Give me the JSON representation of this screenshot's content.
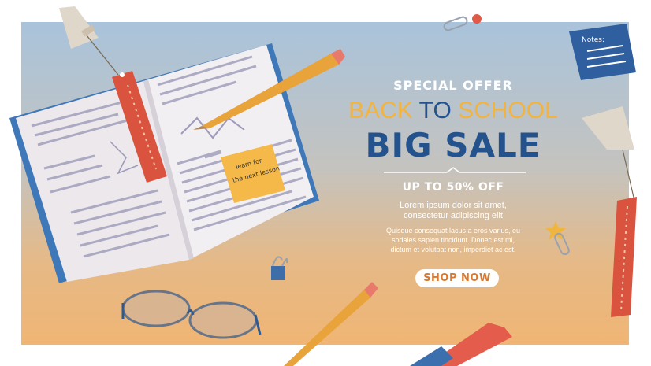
{
  "banner": {
    "special_offer": "SPECIAL OFFER",
    "headline_part1": "BACK",
    "headline_part2": "TO",
    "headline_part3": "SCHOOL",
    "big_sale": "BIG SALE",
    "discount": "UP TO 50% OFF",
    "lead_text": "Lorem ipsum dolor sit amet, consectetur adipiscing elit",
    "body_text": "Quisque consequat lacus a eros varius, eu sodales sapien tincidunt. Donec est mi, dictum et volutpat non, imperdiet ac est.",
    "cta_label": "SHOP NOW"
  },
  "sticky_note": {
    "text_line1": "learn for",
    "text_line2": "the next lesson"
  },
  "notes_card": {
    "title": "Notes:"
  },
  "colors": {
    "accent_orange": "#f2b33f",
    "headline_blue": "#24528c",
    "cta_text": "#d9782f",
    "bookmark_red": "#d9533f"
  }
}
